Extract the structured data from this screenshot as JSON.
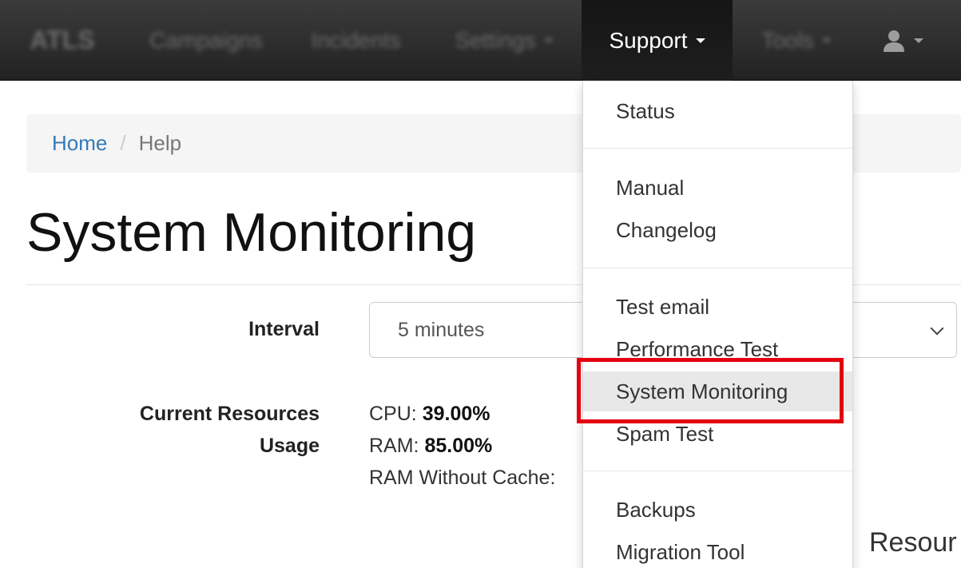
{
  "navbar": {
    "brand": "ATLS",
    "items": [
      {
        "label": "Campaigns"
      },
      {
        "label": "Incidents"
      },
      {
        "label": "Settings"
      },
      {
        "label": "Support"
      },
      {
        "label": "Tools"
      }
    ],
    "user_icon": "user-icon"
  },
  "breadcrumb": {
    "home": "Home",
    "separator": "/",
    "current": "Help"
  },
  "page": {
    "title": "System Monitoring"
  },
  "form": {
    "interval_label": "Interval",
    "interval_value": "5 minutes",
    "usage_label_line1": "Current Resources",
    "usage_label_line2": "Usage",
    "cpu_label": "CPU: ",
    "cpu_value": "39.00%",
    "ram_label": "RAM: ",
    "ram_value": "85.00%",
    "ram_no_cache_label": "RAM Without Cache:",
    "section_partial": "Resour"
  },
  "dropdown": {
    "items": [
      {
        "label": "Status"
      },
      {
        "label": "Manual"
      },
      {
        "label": "Changelog"
      },
      {
        "label": "Test email"
      },
      {
        "label": "Performance Test"
      },
      {
        "label": "System Monitoring"
      },
      {
        "label": "Spam Test"
      },
      {
        "label": "Backups"
      },
      {
        "label": "Migration Tool"
      }
    ],
    "active": "System Monitoring",
    "highlight_color": "#e3000f"
  }
}
